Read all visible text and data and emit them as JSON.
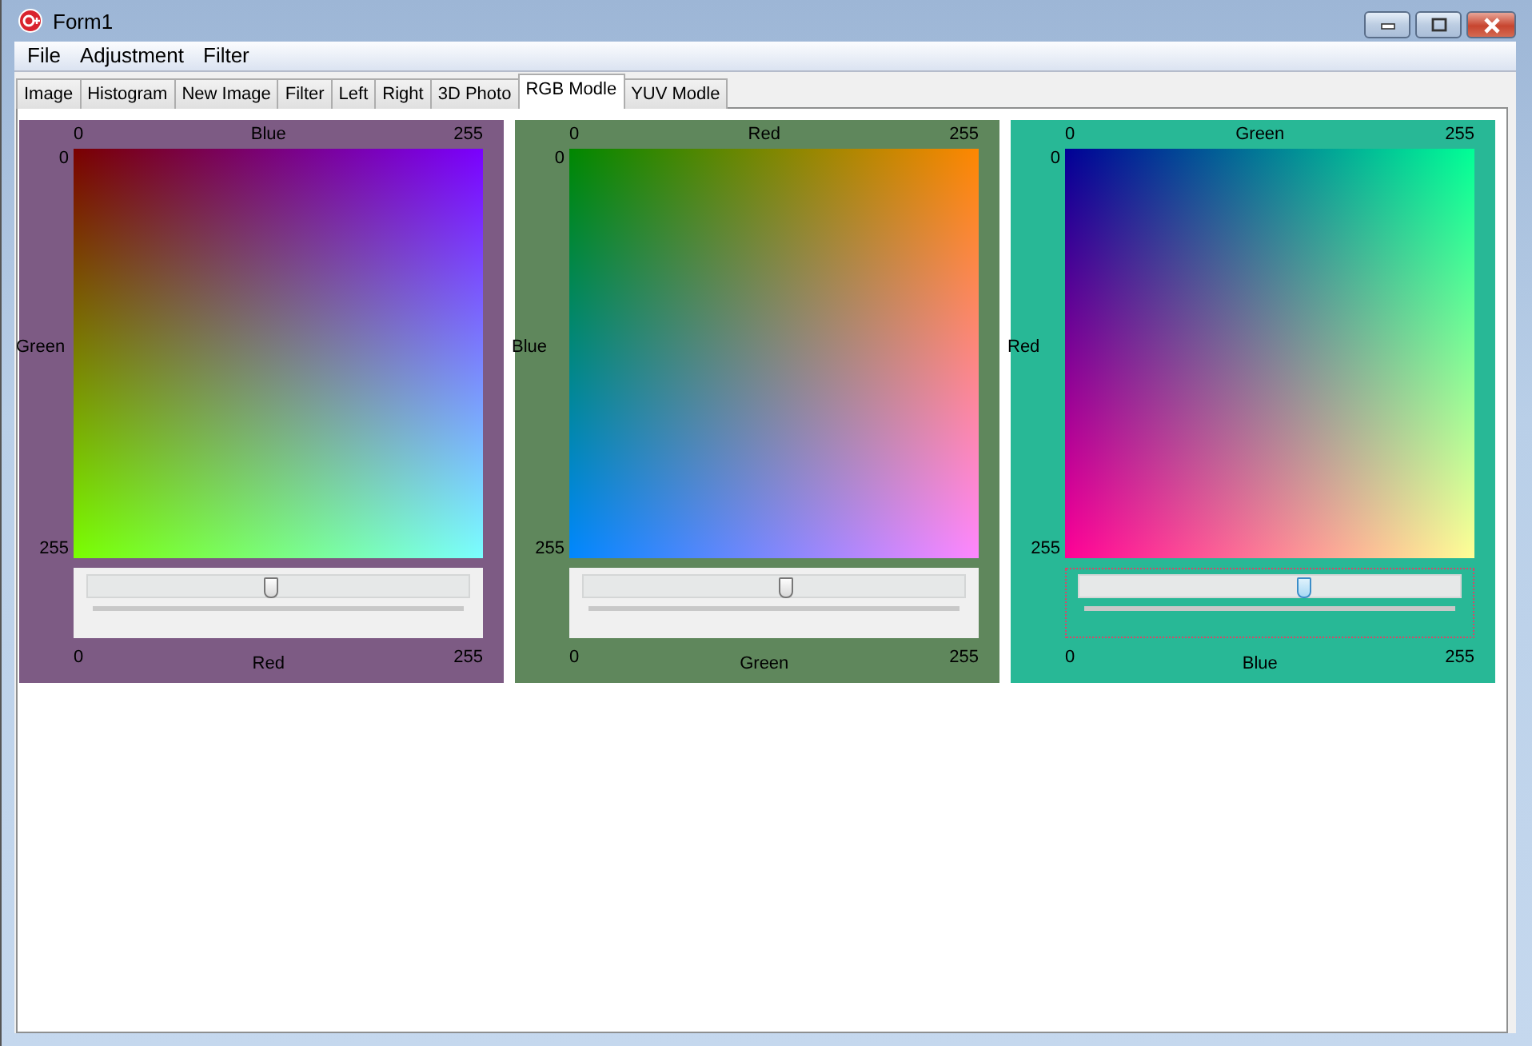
{
  "window": {
    "title": "Form1"
  },
  "menu": [
    "File",
    "Adjustment",
    "Filter"
  ],
  "tabs": [
    {
      "label": "Image",
      "selected": false
    },
    {
      "label": "Histogram",
      "selected": false
    },
    {
      "label": "New Image",
      "selected": false
    },
    {
      "label": "Filter",
      "selected": false
    },
    {
      "label": "Left",
      "selected": false
    },
    {
      "label": "Right",
      "selected": false
    },
    {
      "label": "3D Photo",
      "selected": false
    },
    {
      "label": "RGB Modle",
      "selected": true
    },
    {
      "label": "YUV Modle",
      "selected": false
    }
  ],
  "panels": [
    {
      "color": "#7d5b84",
      "x_axis": {
        "name": "Blue",
        "min": "0",
        "max": "255"
      },
      "y_axis": {
        "name": "Green",
        "min": "0",
        "max": "255"
      },
      "slider": {
        "name": "Red",
        "min": "0",
        "max": "255",
        "level": 0.48,
        "focused": false
      },
      "kind": "red"
    },
    {
      "color": "#5f875c",
      "x_axis": {
        "name": "Red",
        "min": "0",
        "max": "255"
      },
      "y_axis": {
        "name": "Blue",
        "min": "0",
        "max": "255"
      },
      "slider": {
        "name": "Green",
        "min": "0",
        "max": "255",
        "level": 0.53,
        "focused": false
      },
      "kind": "green"
    },
    {
      "color": "#28b896",
      "x_axis": {
        "name": "Green",
        "min": "0",
        "max": "255"
      },
      "y_axis": {
        "name": "Red",
        "min": "0",
        "max": "255"
      },
      "slider": {
        "name": "Blue",
        "min": "0",
        "max": "255",
        "level": 0.59,
        "focused": true
      },
      "kind": "blue"
    }
  ]
}
